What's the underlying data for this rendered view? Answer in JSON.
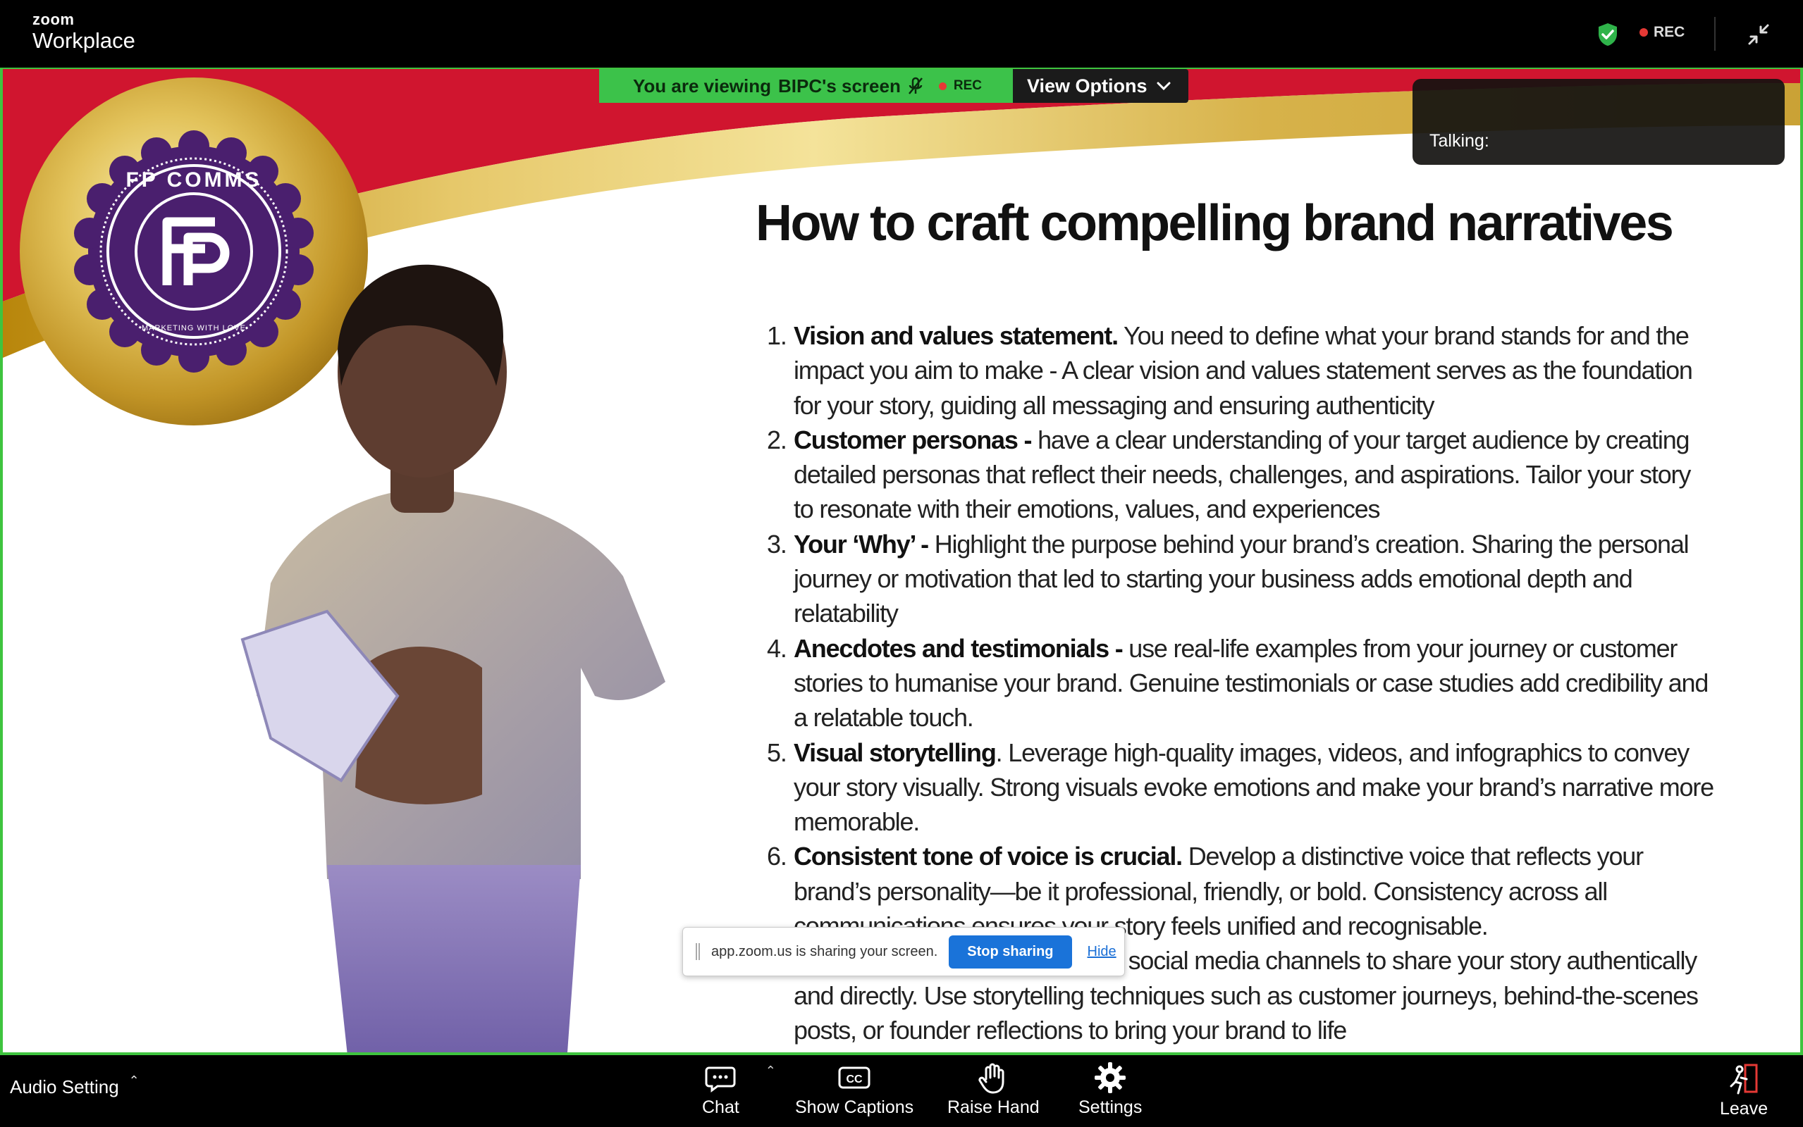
{
  "app": {
    "brand_small": "zoom",
    "brand_large": "Workplace",
    "rec_label": "REC"
  },
  "banner": {
    "viewing_prefix": "You are viewing",
    "viewing_name": "BIPC's screen",
    "rec_label": "REC",
    "view_options": "View Options"
  },
  "talking": {
    "label": "Talking:"
  },
  "slide": {
    "logo_text_top": "FP COMMS",
    "logo_text_bottom": "MARKETING WITH LOVE",
    "title": "How to craft compelling brand narratives",
    "points": [
      {
        "num": "1.",
        "bold": "Vision and values statement.",
        "text": "  You need to define what your brand stands for and the impact you aim to make - A clear vision and values statement serves as the foundation for your story, guiding all messaging and ensuring authenticity"
      },
      {
        "num": "2.",
        "bold": "Customer personas  -",
        "text": "  have a clear understanding of your target audience by creating detailed personas that reflect their needs, challenges, and aspirations.  Tailor your story to resonate with their emotions, values, and experiences"
      },
      {
        "num": "3.",
        "bold": "Your ‘Why’ -",
        "text": " Highlight the purpose behind your brand’s creation. Sharing the personal journey or motivation that led to starting your business adds emotional depth and relatability"
      },
      {
        "num": "4.",
        "bold": "Anecdotes and testimonials -",
        "text": " use real-life examples from your journey or customer stories to humanise your brand. Genuine testimonials or case studies add credibility and a relatable touch."
      },
      {
        "num": "5.",
        "bold": "Visual storytelling",
        "text": ".  Leverage high-quality images, videos, and infographics to convey your story visually.  Strong visuals evoke emotions and make your brand’s narrative more memorable."
      },
      {
        "num": "6.",
        "bold": "Consistent tone of voice is crucial.",
        "text": "  Develop a distinctive voice that reflects your brand’s personality—be it professional, friendly, or bold.  Consistency across all communications ensures your story feels unified and recognisable."
      },
      {
        "num": "7.",
        "bold": "",
        "text": "rms like your website, blog, and social media channels to share your story authentically and directly. Use storytelling techniques such as customer journeys, behind-the-scenes posts, or founder reflections to bring your brand to life"
      }
    ]
  },
  "share_notice": {
    "message": "app.zoom.us is sharing your screen.",
    "stop": "Stop sharing",
    "hide": "Hide"
  },
  "controls": {
    "audio": "Audio Setting",
    "chat": "Chat",
    "captions": "Show Captions",
    "raise_hand": "Raise Hand",
    "settings": "Settings",
    "leave": "Leave"
  },
  "colors": {
    "share_border": "#3fc43f",
    "banner_green": "#3cc24a",
    "stop_button": "#1a73d9",
    "slide_red": "#d0152f",
    "logo_purple": "#4a1f6e"
  }
}
